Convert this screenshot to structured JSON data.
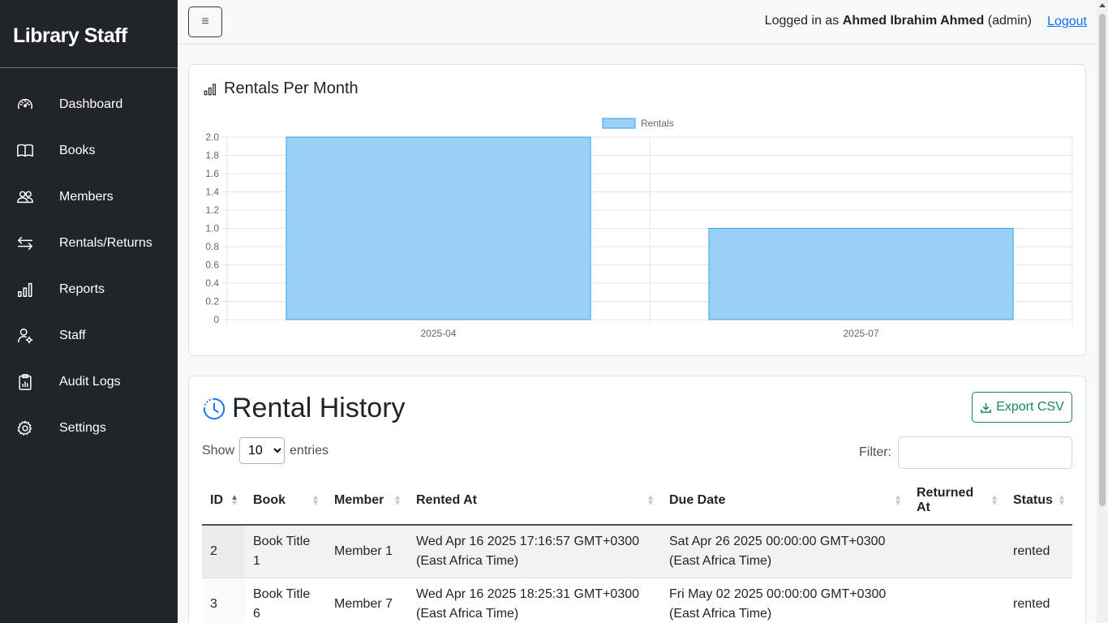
{
  "sidebar": {
    "brand": "Library Staff",
    "items": [
      {
        "label": "Dashboard",
        "icon": "speedometer-icon"
      },
      {
        "label": "Books",
        "icon": "book-icon"
      },
      {
        "label": "Members",
        "icon": "people-icon"
      },
      {
        "label": "Rentals/Returns",
        "icon": "arrows-exchange-icon"
      },
      {
        "label": "Reports",
        "icon": "bar-chart-icon"
      },
      {
        "label": "Staff",
        "icon": "person-gear-icon"
      },
      {
        "label": "Audit Logs",
        "icon": "clipboard-data-icon"
      },
      {
        "label": "Settings",
        "icon": "gear-icon"
      }
    ]
  },
  "topbar": {
    "toggle_label": "≡",
    "logged_in_prefix": "Logged in as",
    "user_name": "Ahmed Ibrahim Ahmed",
    "user_role": "(admin)",
    "logout_label": "Logout"
  },
  "chart_card": {
    "title": "Rentals Per Month"
  },
  "chart_data": {
    "type": "bar",
    "title": "Rentals Per Month",
    "categories": [
      "2025-04",
      "2025-07"
    ],
    "series": [
      {
        "name": "Rentals",
        "values": [
          2,
          1
        ]
      }
    ],
    "ylim": [
      0,
      2.0
    ],
    "yticks": [
      "0",
      "0.2",
      "0.4",
      "0.6",
      "0.8",
      "1.0",
      "1.2",
      "1.4",
      "1.6",
      "1.8",
      "2.0"
    ],
    "grid": true,
    "legend": "top-center",
    "colors": {
      "fill": "#9ad0f5",
      "stroke": "#36a2eb"
    }
  },
  "history": {
    "title": "Rental History",
    "export_label": "Export CSV",
    "show_label": "Show",
    "entries_label": "entries",
    "page_size": "10",
    "page_size_options": [
      "10"
    ],
    "filter_label": "Filter:",
    "filter_value": "",
    "columns": [
      "ID",
      "Book",
      "Member",
      "Rented At",
      "Due Date",
      "Returned At",
      "Status"
    ],
    "rows": [
      {
        "id": "2",
        "book": "Book Title 1",
        "member": "Member 1",
        "rented_at": "Wed Apr 16 2025 17:16:57 GMT+0300 (East Africa Time)",
        "due_date": "Sat Apr 26 2025 00:00:00 GMT+0300 (East Africa Time)",
        "returned_at": "",
        "status": "rented"
      },
      {
        "id": "3",
        "book": "Book Title 6",
        "member": "Member 7",
        "rented_at": "Wed Apr 16 2025 18:25:31 GMT+0300 (East Africa Time)",
        "due_date": "Fri May 02 2025 00:00:00 GMT+0300 (East Africa Time)",
        "returned_at": "",
        "status": "rented"
      }
    ]
  }
}
